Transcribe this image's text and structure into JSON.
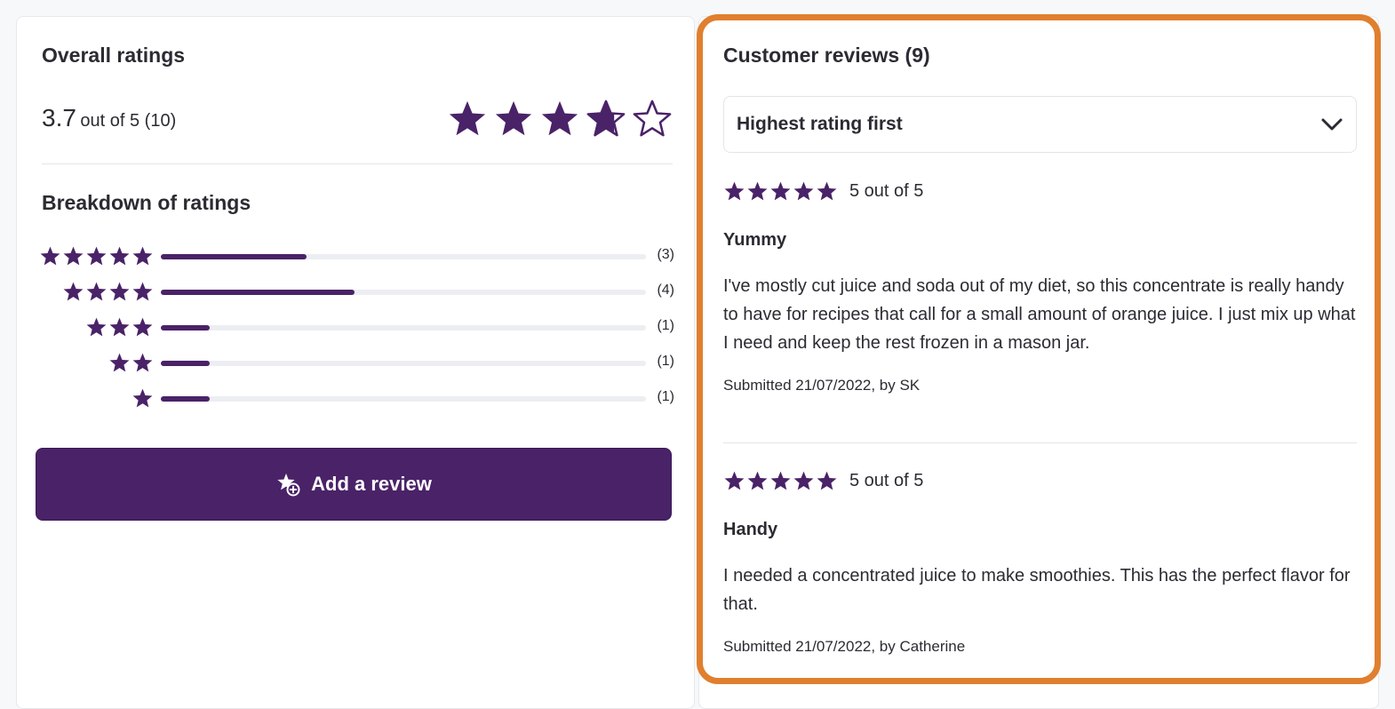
{
  "colors": {
    "accent": "#4a2268",
    "track": "#eceef2",
    "highlight": "#e07f2e",
    "text": "#2b2b33"
  },
  "overall": {
    "title": "Overall ratings",
    "value": "3.7",
    "out_of_text": "out of 5 (10)",
    "rating": 3.7,
    "max": 5
  },
  "breakdown": {
    "title": "Breakdown of ratings",
    "rows": [
      {
        "stars": 5,
        "count_label": "(3)",
        "count": 3
      },
      {
        "stars": 4,
        "count_label": "(4)",
        "count": 4
      },
      {
        "stars": 3,
        "count_label": "(1)",
        "count": 1
      },
      {
        "stars": 2,
        "count_label": "(1)",
        "count": 1
      },
      {
        "stars": 1,
        "count_label": "(1)",
        "count": 1
      }
    ]
  },
  "add_review": {
    "label": "Add a review",
    "icon": "star-plus-icon"
  },
  "reviews": {
    "title": "Customer reviews (9)",
    "sort": {
      "selected": "Highest rating first",
      "icon": "chevron-down-icon"
    },
    "items": [
      {
        "stars": 5,
        "score_text": "5 out of 5",
        "title": "Yummy",
        "body": "I've mostly cut juice and soda out of my diet, so this concentrate is really handy to have for recipes that call for a small amount of orange juice. I just mix up what I need and keep the rest frozen in a mason jar.",
        "meta": "Submitted 21/07/2022, by SK"
      },
      {
        "stars": 5,
        "score_text": "5 out of 5",
        "title": "Handy",
        "body": "I needed a concentrated juice to make smoothies. This has the perfect flavor for that.",
        "meta": "Submitted 21/07/2022, by Catherine"
      }
    ]
  }
}
